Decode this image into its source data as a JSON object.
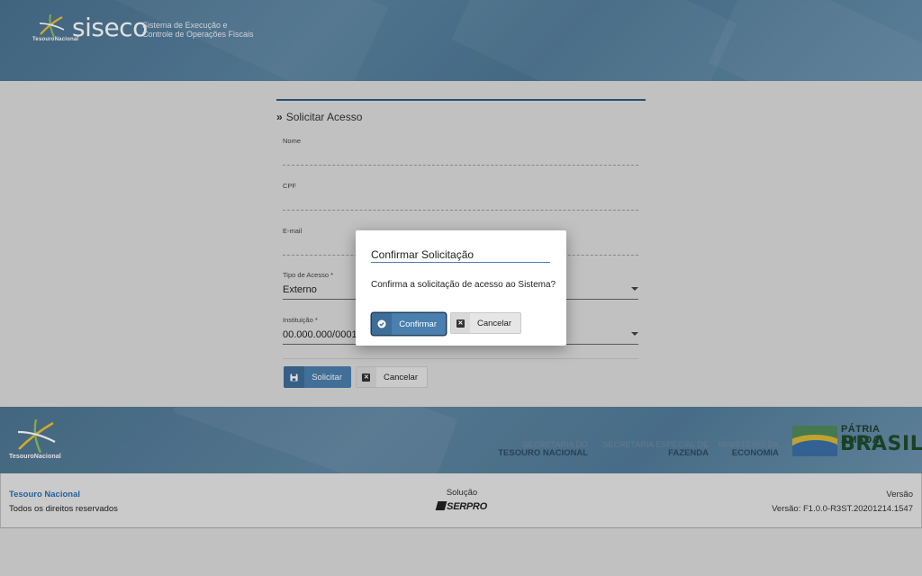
{
  "header": {
    "brand": "siseco",
    "brand_mark_text": "TesouroNacional",
    "subtitle_line1": "Sistema de Execução e",
    "subtitle_line2": "Controle de Operações Fiscais"
  },
  "form": {
    "title": "Solicitar Acesso",
    "fields": {
      "nome": {
        "label": "Nome",
        "value": ""
      },
      "cpf": {
        "label": "CPF",
        "value": ""
      },
      "email": {
        "label": "E-mail",
        "value": ""
      },
      "tipo_acesso": {
        "label": "Tipo de Acesso *",
        "value": "Externo"
      },
      "instituicao": {
        "label": "Instituição *",
        "value": "00.000.000/0001-"
      }
    },
    "solicitar_label": "Solicitar",
    "cancelar_label": "Cancelar"
  },
  "modal": {
    "title": "Confirmar Solicitação",
    "message": "Confirma a solicitação de acesso ao Sistema?",
    "confirm_label": "Confirmar",
    "cancel_label": "Cancelar"
  },
  "footer_band": {
    "tn_logo_text": "TesouroNacional",
    "org1_line1": "SECRETARIA DO",
    "org1_line2": "TESOURO NACIONAL",
    "org2_line1": "SECRETARIA ESPECIAL DE",
    "org2_line2": "FAZENDA",
    "org3_line1": "MINISTÉRIO DA",
    "org3_line2": "ECONOMIA",
    "patria_line1": "PÁTRIA AMADA",
    "patria_line2": "BRASIL"
  },
  "bottom": {
    "left_name": "Tesouro Nacional",
    "left_rights": "Todos os direitos reservados",
    "mid_label": "Solução",
    "mid_logo": "SERPRO",
    "right_label": "Versão",
    "right_version": "Versão: F1.0.0-R3ST.20201214.1547"
  },
  "colors": {
    "primary": "#4a7fae",
    "header": "#4a7290",
    "link": "#2a6fb5"
  }
}
